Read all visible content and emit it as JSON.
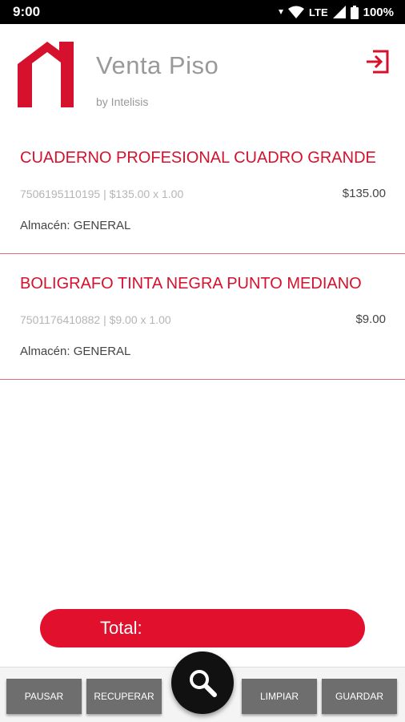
{
  "status_bar": {
    "time": "9:00",
    "network": "LTE",
    "battery": "100%"
  },
  "header": {
    "title": "Venta Piso",
    "subtitle": "by Intelisis",
    "logo_icon": "house-logo-icon",
    "logout_icon": "logout-icon"
  },
  "items": [
    {
      "name": "CUADERNO PROFESIONAL CUADRO GRANDE",
      "detail": "7506195110195 | $135.00 x 1.00",
      "price": "$135.00",
      "almacen": "Almacén: GENERAL"
    },
    {
      "name": "BOLIGRAFO TINTA NEGRA PUNTO MEDIANO",
      "detail": "7501176410882 | $9.00 x 1.00",
      "price": "$9.00",
      "almacen": "Almacén: GENERAL"
    }
  ],
  "total": {
    "label": "Total:",
    "value": ""
  },
  "buttons": {
    "pausar": "PAUSAR",
    "recuperar": "RECUPERAR",
    "limpiar": "LIMPIAR",
    "guardar": "GUARDAR",
    "search_icon": "search-icon"
  },
  "colors": {
    "accent": "#d6112d",
    "total_bar": "#e1112e",
    "button_gray": "#6e6e6e",
    "fab": "#111111"
  }
}
